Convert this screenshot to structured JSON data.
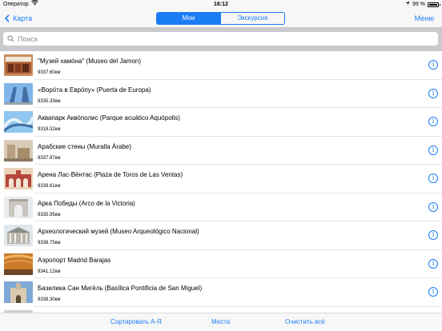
{
  "status": {
    "carrier": "Оператор",
    "time": "16:12",
    "battery_text": "99 %",
    "battery_level": 0.99
  },
  "nav": {
    "back_label": "Карта",
    "segments": [
      "Мои",
      "Экскурсия"
    ],
    "selected_segment": 0,
    "menu_label": "Меню",
    "accent_color": "#1a7cf5"
  },
  "search": {
    "placeholder": "Поиск",
    "value": ""
  },
  "places": [
    {
      "title": "\"Музей хамо́на\" (Museo del Jamon)",
      "distance": "9337.60км"
    },
    {
      "title": "«Воро́та в Евро́пу» (Puerta de Europa)",
      "distance": "9335.33км"
    },
    {
      "title": "Аквапарк Акво̀полис (Parque acuático Aquópolis)",
      "distance": "9318.32км"
    },
    {
      "title": "Арабские стены (Muralla Árabe)",
      "distance": "9337.97км"
    },
    {
      "title": "Арена Лас-Вѐнтас (Plaza de Toros de Las Ventas)",
      "distance": "9339.61км"
    },
    {
      "title": "Арка Победы (Arco de la Victoria)",
      "distance": "9335.95км"
    },
    {
      "title": "Археологический музей (Museo Arqueológico Nacional)",
      "distance": "9338.75км"
    },
    {
      "title": "Аэропорт Madrid Barajas",
      "distance": "9341.12км"
    },
    {
      "title": "Базилика Сан Мигѐль (Basílica Pontificia de San Miguel)",
      "distance": "9338.30км"
    },
    {
      "title": "",
      "distance": ""
    }
  ],
  "toolbar": {
    "sort_label": "Сортировать А-Я",
    "places_label": "Места",
    "clear_label": "Очистить всё"
  }
}
